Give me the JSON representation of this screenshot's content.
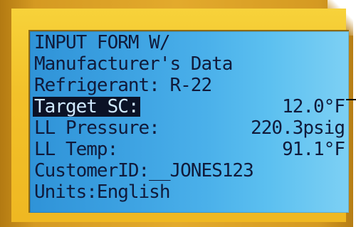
{
  "screen": {
    "lines": [
      {
        "text": "INPUT FORM W/"
      },
      {
        "text": "Manufacturer's Data"
      },
      {
        "text": "Refrigerant: R-22"
      },
      {
        "label": "Target SC:",
        "value": "12.0°F"
      },
      {
        "label": "LL Pressure:",
        "value": "220.3psig"
      },
      {
        "label": "LL Temp:",
        "value": "91.1°F"
      },
      {
        "text": "CustomerID:__JONES123"
      },
      {
        "text": "Units:English"
      }
    ]
  },
  "colors": {
    "frame": "#e3aa2c",
    "bezel": "#f2c12a",
    "lcd": "#3a9fe0",
    "lcd_text": "#101a3a",
    "highlight": "#0b1226"
  }
}
